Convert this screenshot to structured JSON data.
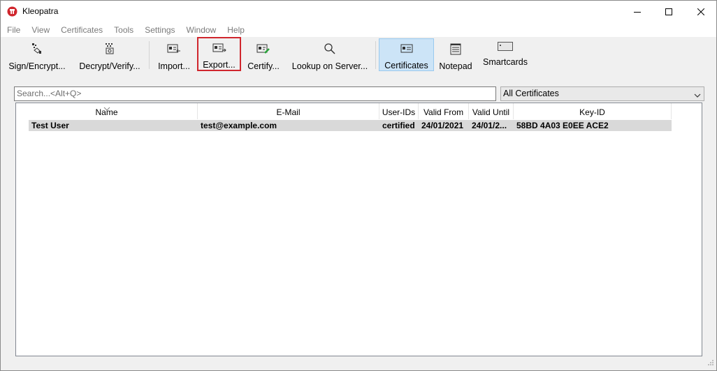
{
  "window": {
    "title": "Kleopatra",
    "icon": "kleopatra-app-icon",
    "controls": [
      "minimize-icon",
      "maximize-icon",
      "close-icon"
    ]
  },
  "menubar": {
    "items": [
      "File",
      "View",
      "Certificates",
      "Tools",
      "Settings",
      "Window",
      "Help"
    ]
  },
  "toolbar": {
    "buttons": [
      {
        "label": "Sign/Encrypt...",
        "icon": "sign-encrypt-icon"
      },
      {
        "label": "Decrypt/Verify...",
        "icon": "decrypt-verify-icon"
      },
      {
        "label": "Import...",
        "icon": "import-icon"
      },
      {
        "label": "Export...",
        "icon": "export-icon",
        "highlighted": true
      },
      {
        "label": "Certify...",
        "icon": "certify-icon"
      },
      {
        "label": "Lookup on Server...",
        "icon": "search-icon"
      },
      {
        "label": "Certificates",
        "icon": "certificates-icon",
        "active": true
      },
      {
        "label": "Notepad",
        "icon": "notepad-icon"
      },
      {
        "label": "Smartcards",
        "icon": "smartcard-icon"
      }
    ]
  },
  "search": {
    "placeholder": "Search...<Alt+Q>",
    "value": ""
  },
  "filter": {
    "selected": "All Certificates"
  },
  "table": {
    "columns": [
      "Name",
      "E-Mail",
      "User-IDs",
      "Valid From",
      "Valid Until",
      "Key-ID"
    ],
    "rows": [
      {
        "name": "Test User",
        "email": "test@example.com",
        "user_ids": "certified",
        "valid_from": "24/01/2021",
        "valid_until": "24/01/2...",
        "key_id": "58BD 4A03 E0EE ACE2"
      }
    ]
  },
  "colors": {
    "active_tab_bg": "#cce4f7",
    "highlight_border": "#d0262d",
    "selected_row_bg": "#d9d9d9"
  }
}
